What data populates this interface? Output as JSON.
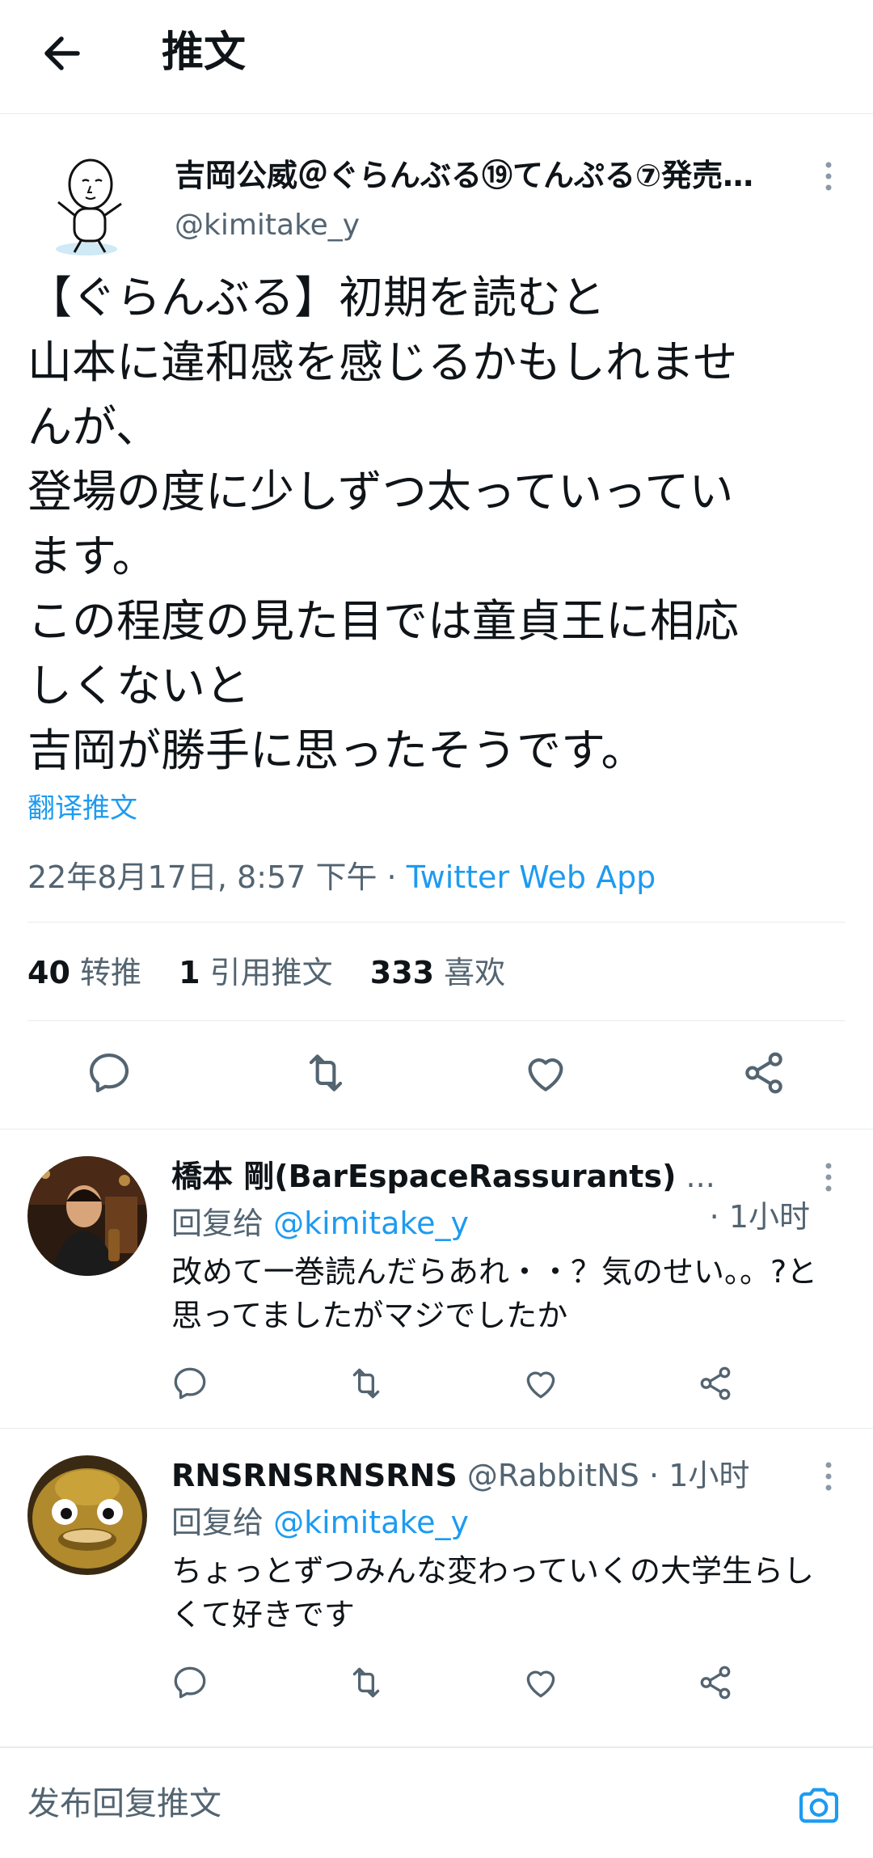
{
  "header": {
    "title": "推文"
  },
  "tweet": {
    "author_name": "吉岡公威＠ぐらんぶる⑲てんぷる⑦発売…",
    "author_handle": "@kimitake_y",
    "text": "【ぐらんぶる】初期を読むと\n山本に違和感を感じるかもしれませ\nんが、\n登場の度に少しずつ太っていってい\nます。\nこの程度の見た目では童貞王に相応\nしくないと\n吉岡が勝手に思ったそうです。",
    "translate_label": "翻译推文",
    "timestamp": "22年8月17日, 8:57 下午 · ",
    "source": "Twitter Web App",
    "stats": {
      "retweets_count": "40",
      "retweets_label": "转推",
      "quotes_count": "1",
      "quotes_label": "引用推文",
      "likes_count": "333",
      "likes_label": "喜欢"
    }
  },
  "replies": [
    {
      "name": "橋本 剛(BarEspaceRassurants)",
      "ellipsis": "...",
      "time": "· 1小时",
      "reply_to_label": "回复给 ",
      "reply_to_handle": "@kimitake_y",
      "text": "改めて一巻読んだらあれ・・？気のせい。。?と思ってましたがマジでしたか"
    },
    {
      "name": "RNSRNSRNSRNS",
      "handle": "@RabbitNS",
      "time": "· 1小时",
      "reply_to_label": "回复给 ",
      "reply_to_handle": "@kimitake_y",
      "text": "ちょっとずつみんな変わっていくの大学生らしくて好きです"
    }
  ],
  "compose": {
    "placeholder": "发布回复推文"
  },
  "colors": {
    "accent": "#1d9bf0",
    "muted": "#536471",
    "text": "#0f1419",
    "divider": "#e6ecf0"
  }
}
